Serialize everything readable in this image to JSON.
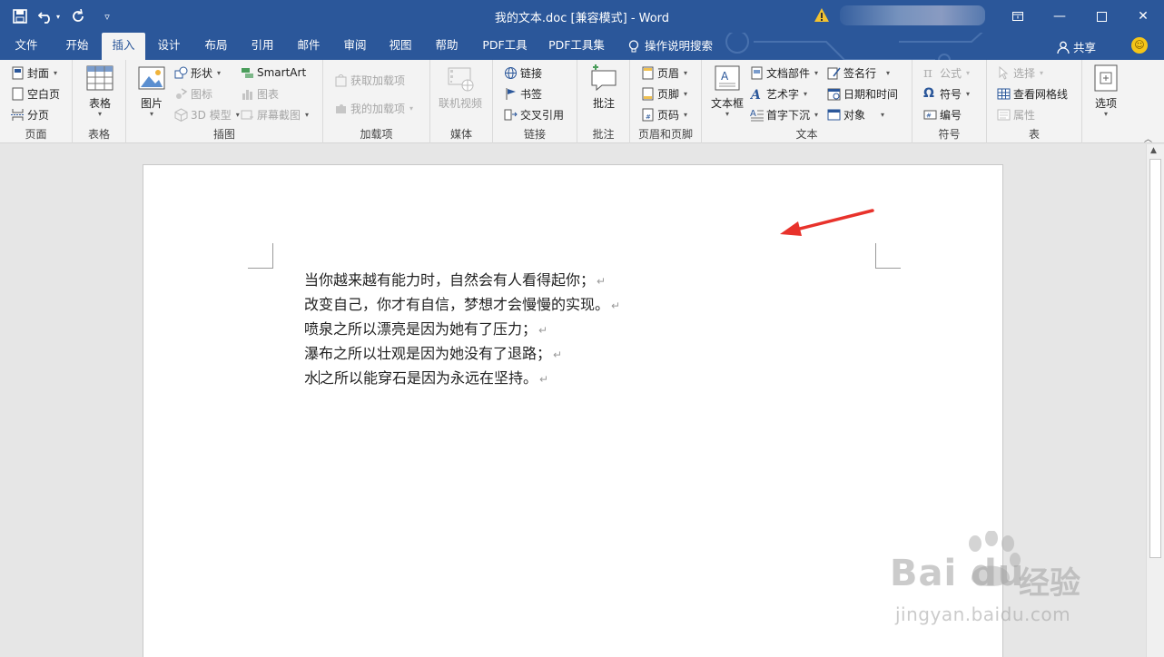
{
  "window": {
    "doc_title": "我的文本.doc [兼容模式]  -  Word",
    "controls": [
      "restore-ribbon",
      "minimize",
      "maximize",
      "close"
    ]
  },
  "tabs": [
    {
      "label": "文件"
    },
    {
      "label": "开始"
    },
    {
      "label": "插入",
      "active": true
    },
    {
      "label": "设计"
    },
    {
      "label": "布局"
    },
    {
      "label": "引用"
    },
    {
      "label": "邮件"
    },
    {
      "label": "审阅"
    },
    {
      "label": "视图"
    },
    {
      "label": "帮助"
    },
    {
      "label": "PDF工具"
    },
    {
      "label": "PDF工具集"
    },
    {
      "label": "操作说明搜索"
    }
  ],
  "share_label": "共享",
  "ribbon": {
    "pages": {
      "label": "页面",
      "cover": "封面",
      "blank": "空白页",
      "break": "分页"
    },
    "tables": {
      "label": "表格",
      "table": "表格"
    },
    "illustrations": {
      "label": "插图",
      "picture": "图片",
      "shapes": "形状",
      "icons": "图标",
      "model3d": "3D 模型",
      "smartart": "SmartArt",
      "chart": "图表",
      "screenshot": "屏幕截图"
    },
    "addins": {
      "label": "加载项",
      "get": "获取加载项",
      "my": "我的加载项"
    },
    "media": {
      "label": "媒体",
      "video": "联机视频"
    },
    "links": {
      "label": "链接",
      "link": "链接",
      "bookmark": "书签",
      "crossref": "交叉引用"
    },
    "comments": {
      "label": "批注",
      "comment": "批注"
    },
    "header_footer": {
      "label": "页眉和页脚",
      "header": "页眉",
      "footer": "页脚",
      "pagenum": "页码"
    },
    "text": {
      "label": "文本",
      "textbox": "文本框",
      "quickparts": "文档部件",
      "wordart": "艺术字",
      "dropcap": "首字下沉",
      "signature": "签名行",
      "datetime": "日期和时间",
      "object": "对象"
    },
    "symbols": {
      "label": "符号",
      "equation": "公式",
      "symbol": "符号",
      "numbering": "编号"
    },
    "table_tools": {
      "label": "表",
      "select": "选择",
      "gridlines": "查看网格线",
      "properties": "属性"
    },
    "options": {
      "options": "选项"
    }
  },
  "document": {
    "paragraphs": [
      "当你越来越有能力时，自然会有人看得起你；",
      "改变自己，你才有自信，梦想才会慢慢的实现。",
      "喷泉之所以漂亮是因为她有了压力；",
      "瀑布之所以壮观是因为她没有了退路；",
      "水之所以能穿石是因为永远在坚持。"
    ],
    "cursor_after_char": 1,
    "paragraph_mark": "↵"
  },
  "watermark": {
    "brand": "Bai du",
    "cn": "经验",
    "url": "jingyan.baidu.com"
  },
  "colors": {
    "title_bar": "#2b579a",
    "ribbon": "#f3f3f3",
    "arrow": "#e8322b"
  }
}
